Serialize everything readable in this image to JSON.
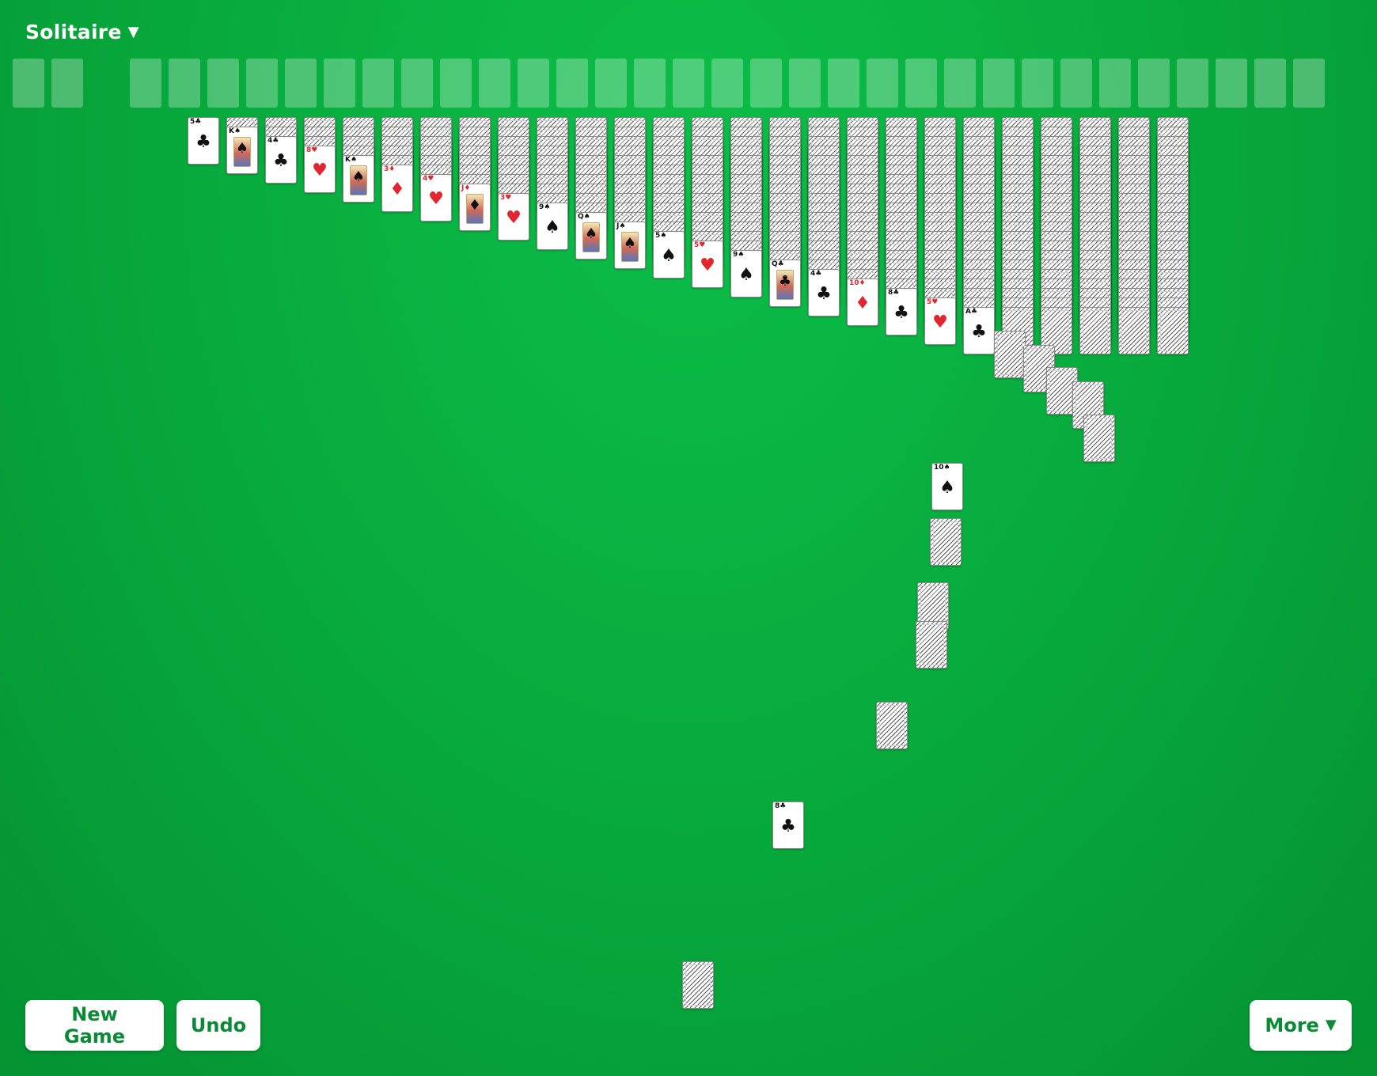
{
  "header": {
    "title": "Solitaire",
    "caret_icon": "chevron-down-icon"
  },
  "footer": {
    "new_game_label": "New Game",
    "undo_label": "Undo",
    "more_label": "More"
  },
  "suits": {
    "clubs": "♣",
    "spades": "♠",
    "hearts": "♥",
    "diamonds": "♦"
  },
  "colors": {
    "felt": "#07a83c",
    "button_text": "#0a8a36",
    "red_suit": "#e0262e",
    "black_suit": "#111111"
  },
  "tableau": [
    {
      "face_down": 0,
      "top": {
        "rank": "5",
        "suit": "clubs"
      }
    },
    {
      "face_down": 1,
      "top": {
        "rank": "K",
        "suit": "spades"
      }
    },
    {
      "face_down": 2,
      "top": {
        "rank": "4",
        "suit": "clubs"
      }
    },
    {
      "face_down": 3,
      "top": {
        "rank": "8",
        "suit": "hearts"
      }
    },
    {
      "face_down": 4,
      "top": {
        "rank": "K",
        "suit": "spades"
      }
    },
    {
      "face_down": 5,
      "top": {
        "rank": "3",
        "suit": "diamonds"
      }
    },
    {
      "face_down": 6,
      "top": {
        "rank": "4",
        "suit": "hearts"
      }
    },
    {
      "face_down": 7,
      "top": {
        "rank": "J",
        "suit": "diamonds"
      }
    },
    {
      "face_down": 8,
      "top": {
        "rank": "3",
        "suit": "hearts"
      }
    },
    {
      "face_down": 9,
      "top": {
        "rank": "9",
        "suit": "spades"
      }
    },
    {
      "face_down": 10,
      "top": {
        "rank": "Q",
        "suit": "spades"
      }
    },
    {
      "face_down": 11,
      "top": {
        "rank": "J",
        "suit": "spades"
      }
    },
    {
      "face_down": 12,
      "top": {
        "rank": "5",
        "suit": "spades"
      }
    },
    {
      "face_down": 13,
      "top": {
        "rank": "5",
        "suit": "hearts"
      }
    },
    {
      "face_down": 14,
      "top": {
        "rank": "9",
        "suit": "spades"
      }
    },
    {
      "face_down": 15,
      "top": {
        "rank": "Q",
        "suit": "clubs"
      }
    },
    {
      "face_down": 16,
      "top": {
        "rank": "4",
        "suit": "clubs"
      }
    },
    {
      "face_down": 17,
      "top": {
        "rank": "10",
        "suit": "diamonds"
      }
    },
    {
      "face_down": 18,
      "top": {
        "rank": "8",
        "suit": "clubs"
      }
    },
    {
      "face_down": 19,
      "top": {
        "rank": "5",
        "suit": "hearts"
      }
    },
    {
      "face_down": 20,
      "top": {
        "rank": "A",
        "suit": "clubs"
      }
    },
    {
      "face_down": 21,
      "top": null
    },
    {
      "face_down": 21,
      "top": null
    },
    {
      "face_down": 21,
      "top": null
    },
    {
      "face_down": 21,
      "top": null
    },
    {
      "face_down": 21,
      "top": null
    }
  ],
  "flying_cards": [
    {
      "face_up": false
    },
    {
      "face_up": false
    },
    {
      "face_up": false
    },
    {
      "face_up": false
    },
    {
      "face_up": false
    },
    {
      "face_up": true,
      "rank": "10",
      "suit": "spades"
    },
    {
      "face_up": false
    },
    {
      "face_up": false
    },
    {
      "face_up": false
    },
    {
      "face_up": false
    },
    {
      "face_up": true,
      "rank": "8",
      "suit": "clubs"
    },
    {
      "face_up": false
    }
  ]
}
